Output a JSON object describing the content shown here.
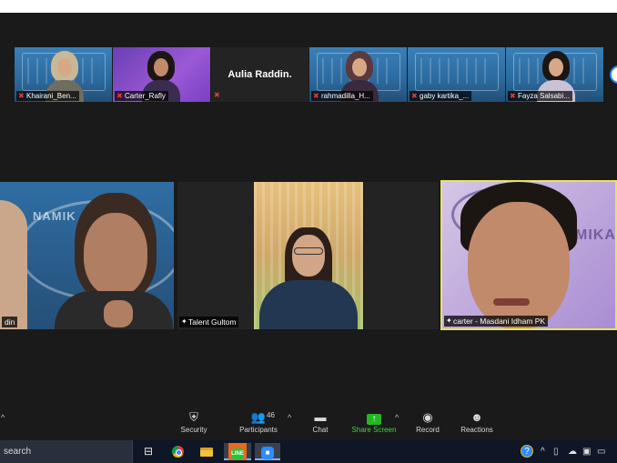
{
  "top_strip": {
    "participants": [
      {
        "name": "Khairani_Ben...",
        "muted": true
      },
      {
        "name": "Carter_Rafly",
        "muted": true
      },
      {
        "name": "Aulia Raddin.",
        "muted": true,
        "video_off": true
      },
      {
        "name": "rahmadilla_H...",
        "muted": true
      },
      {
        "name": "gaby kartika_...",
        "muted": true
      },
      {
        "name": "Fayza Salsabi...",
        "muted": true
      }
    ]
  },
  "gallery": {
    "tiles": [
      {
        "name": "din",
        "brand": "NAMIK"
      },
      {
        "name": "Talent Gultom"
      },
      {
        "name": ""
      },
      {
        "name": "carter - Masdani Idham PK",
        "brand": "MIKA",
        "active": true
      }
    ]
  },
  "toolbar": {
    "security": "Security",
    "participants": "Participants",
    "participants_count": "46",
    "chat": "Chat",
    "share_screen": "Share Screen",
    "record": "Record",
    "reactions": "Reactions"
  },
  "taskbar": {
    "search_text": "search",
    "apps": [
      "task-view-icon",
      "chrome-icon",
      "file-explorer-icon",
      "line-icon",
      "zoom-icon"
    ]
  },
  "colors": {
    "accent_blue": "#2d8cff",
    "share_green": "#23b723",
    "active_speaker": "#e8e35a",
    "muted_red": "#e03c31"
  }
}
